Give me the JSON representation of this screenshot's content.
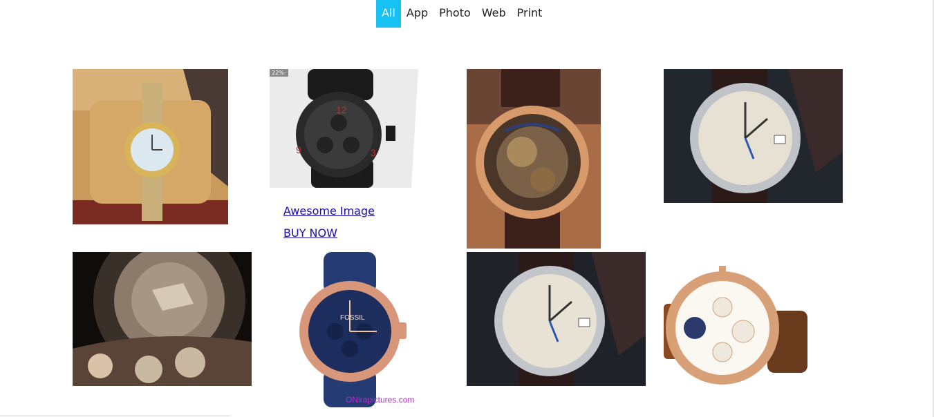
{
  "filters": [
    {
      "label": "All",
      "active": true
    },
    {
      "label": "App",
      "active": false
    },
    {
      "label": "Photo",
      "active": false
    },
    {
      "label": "Web",
      "active": false
    },
    {
      "label": "Print",
      "active": false
    }
  ],
  "gallery": {
    "overlay": {
      "title_link": "Awesome Image",
      "cta_link": "BUY NOW"
    },
    "badge": "22%-",
    "watermark": "ONirapictures.com"
  },
  "colors": {
    "active_filter": "#17c1f2",
    "link": "#1a0dab"
  }
}
